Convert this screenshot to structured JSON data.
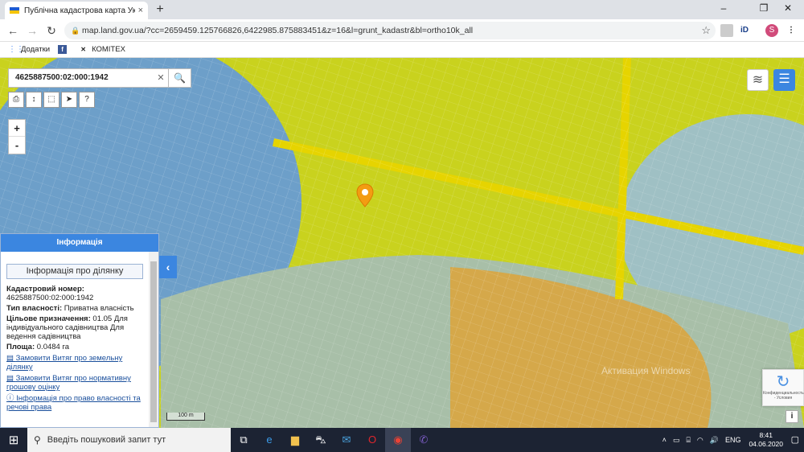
{
  "browser": {
    "tab_title": "Публічна кадастрова карта Укр",
    "tab_close": "×",
    "new_tab": "+",
    "url": "map.land.gov.ua/?cc=2659459.125766826,6422985.875883451&z=16&l=grunt_kadastr&bl=ortho10k_all",
    "window_controls": {
      "minimize": "–",
      "maximize": "❐",
      "close": "✕"
    },
    "profile_initial": "S",
    "extensions": [
      "bookmark-manager-icon",
      "id-extension-icon"
    ],
    "ext_id_label": "iD"
  },
  "bookmarks": [
    {
      "label": "Додатки",
      "icon": "apps-grid-icon"
    },
    {
      "label": "",
      "icon": "facebook-icon"
    },
    {
      "label": "КОМІТЕХ",
      "icon": "komitex-icon"
    }
  ],
  "map": {
    "search_value": "4625887500:02:000:1942",
    "zoom_in": "+",
    "zoom_out": "-",
    "scale_label": "100 m",
    "watermark": "Активация Windows",
    "recaptcha_text": "Конфиденциальность - Условия",
    "info_button": "i",
    "colors": {
      "yellow_zone": "#c9d21e",
      "blue_zone": "#6d9fc9",
      "orange_zone": "#d5a84a",
      "marker": "#f39c12",
      "accent": "#3b86e0"
    }
  },
  "panel": {
    "header": "Інформація",
    "subtitle": "Інформація про ділянку",
    "cadastral_label": "Кадастровий номер:",
    "cadastral_value": "4625887500:02:000:1942",
    "ownership_label": "Тип власності:",
    "ownership_value": "Приватна власність",
    "purpose_label": "Цільове призначення:",
    "purpose_value": "01.05 Для індивідуального садівництва Для ведення садівництва",
    "area_label": "Площа:",
    "area_value": "0.0484 га",
    "links": [
      {
        "icon": "document-icon",
        "label": "Замовити Витяг про земельну ділянку"
      },
      {
        "icon": "document-icon",
        "label": "Замовити Витяг про нормативну грошову оцінку"
      },
      {
        "icon": "info-icon",
        "label": "Інформація про право власності та речові права"
      }
    ],
    "collapse_arrow": "‹"
  },
  "taskbar": {
    "search_placeholder": "Введіть пошуковий запит тут",
    "lang": "ENG",
    "time": "8:41",
    "date": "04.06.2020"
  }
}
